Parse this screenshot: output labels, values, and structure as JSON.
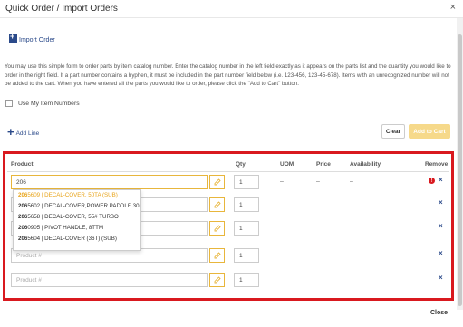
{
  "window": {
    "title": "Quick Order / Import Orders",
    "close_glyph": "×"
  },
  "import_link": {
    "label": "Import Order",
    "icon": "import-document-icon"
  },
  "instructions": "You may use this simple form to order parts by item catalog number. Enter the catalog number in the left field exactly as it appears on the parts list and the quantity you would like to order in the right field. If a part number contains a hyphen, it must be included in the part number field below (i.e. 123-456, 123-45-678). Items with an unrecognized number will not be added to the cart. When you have entered all the parts you would like to order, please click the \"Add to Cart\" button.",
  "use_item_numbers": {
    "label": "Use My Item Numbers",
    "checked": false
  },
  "add_line": {
    "glyph": "+",
    "label": "Add Line"
  },
  "buttons": {
    "clear": "Clear",
    "add_to_cart": "Add to Cart",
    "close": "Close"
  },
  "table": {
    "headers": {
      "product": "Product",
      "qty": "Qty",
      "uom": "UOM",
      "price": "Price",
      "availability": "Availability",
      "remove": "Remove"
    },
    "rows": [
      {
        "product": "206",
        "qty": "1",
        "uom": "–",
        "price": "–",
        "availability": "–",
        "error_glyph": "!",
        "remove_glyph": "×"
      },
      {
        "product": "",
        "qty": "1",
        "remove_glyph": "×"
      },
      {
        "product": "",
        "qty": "1",
        "remove_glyph": "×"
      },
      {
        "product": "",
        "qty": "1",
        "remove_glyph": "×"
      },
      {
        "product": "",
        "qty": "1",
        "remove_glyph": "×"
      }
    ],
    "product_placeholder": "Product #"
  },
  "autocomplete": {
    "match_prefix": "206",
    "options": [
      {
        "rest": "5609 | DECAL-COVER, 50TA (SUB)",
        "highlighted": true
      },
      {
        "rest": "5602 | DECAL-COVER,POWER PADDLE 30",
        "highlighted": false
      },
      {
        "rest": "5658 | DECAL-COVER, 55# TURBO",
        "highlighted": false
      },
      {
        "rest": "0905 | PIVOT HANDLE, 8TTM",
        "highlighted": false
      },
      {
        "rest": "5604 | DECAL-COVER (36T) (SUB)",
        "highlighted": false
      }
    ]
  },
  "colors": {
    "accent_blue": "#2b4a8a",
    "highlight_red": "#d9191f",
    "accent_gold": "#e8b63c"
  }
}
